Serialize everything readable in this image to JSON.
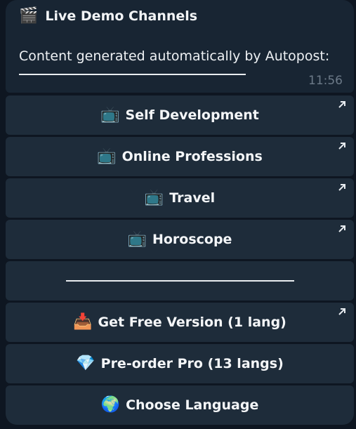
{
  "message": {
    "title_emoji": "🎬",
    "title": "Live Demo Channels",
    "content": "Content generated automatically by Autopost:",
    "time": "11:56"
  },
  "buttons": [
    {
      "emoji": "📺",
      "label": "Self Development",
      "external": true
    },
    {
      "emoji": "📺",
      "label": "Online Professions",
      "external": true
    },
    {
      "emoji": "📺",
      "label": "Travel",
      "external": true
    },
    {
      "emoji": "📺",
      "label": "Horoscope",
      "external": true
    },
    {
      "emoji": "",
      "label": "",
      "external": false
    },
    {
      "emoji": "📥",
      "label": "Get Free Version (1 lang)",
      "external": true
    },
    {
      "emoji": "💎",
      "label": "Pre-order Pro (13 langs)",
      "external": false
    },
    {
      "emoji": "🌍",
      "label": "Choose Language",
      "external": false
    }
  ],
  "colors": {
    "background": "#0e1621",
    "bubble": "#182533",
    "button": "#1e2c3a",
    "text": "#f4f6f8",
    "timestamp": "#6c7a88"
  },
  "icons": {
    "external_link": "arrow-up-right-icon"
  }
}
